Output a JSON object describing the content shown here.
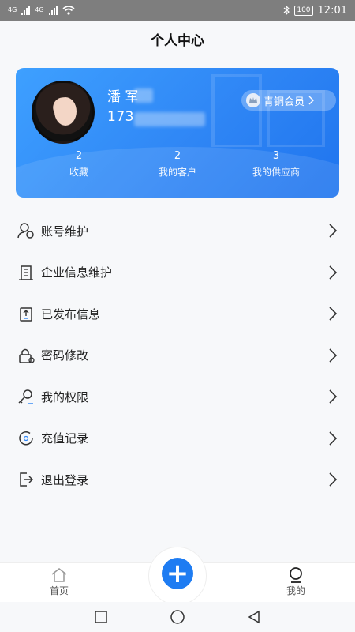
{
  "status_bar": {
    "left_labels": [
      "4G",
      "4G"
    ],
    "battery": "100",
    "time": "12:01"
  },
  "header": {
    "title": "个人中心"
  },
  "profile": {
    "name": "潘 军",
    "phone": "173",
    "member_label": "青铜会员",
    "stats": [
      {
        "value": "2",
        "label": "收藏"
      },
      {
        "value": "2",
        "label": "我的客户"
      },
      {
        "value": "3",
        "label": "我的供应商"
      }
    ]
  },
  "menu": {
    "items": [
      {
        "label": "账号维护",
        "icon": "account-icon"
      },
      {
        "label": "企业信息维护",
        "icon": "building-icon"
      },
      {
        "label": "已发布信息",
        "icon": "upload-icon"
      },
      {
        "label": "密码修改",
        "icon": "lock-icon"
      },
      {
        "label": "我的权限",
        "icon": "key-icon"
      },
      {
        "label": "充值记录",
        "icon": "recharge-icon"
      },
      {
        "label": "退出登录",
        "icon": "logout-icon"
      }
    ]
  },
  "bottom_nav": {
    "home": "首页",
    "mine": "我的",
    "add_symbol": "+"
  },
  "colors": {
    "accent": "#1e7cf2",
    "card_gradient_start": "#3ea0ff",
    "card_gradient_end": "#1f74ee"
  }
}
